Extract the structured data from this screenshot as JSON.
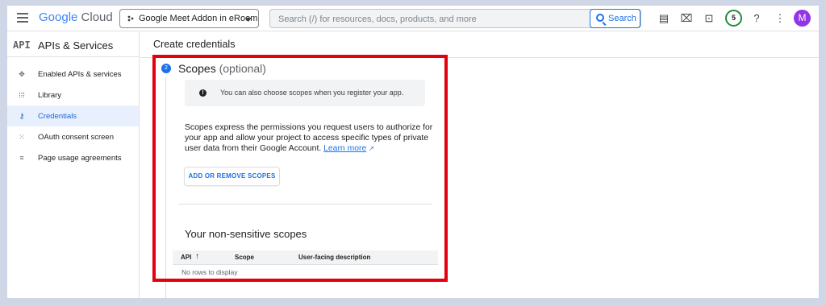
{
  "header": {
    "logo_google": "Google",
    "logo_cloud": "Cloud",
    "project_name": "Google Meet Addon in eRoom",
    "search_placeholder": "Search (/) for resources, docs, products, and more",
    "search_button": "Search",
    "notification_count": "5",
    "avatar_initial": "M"
  },
  "sidebar": {
    "api_icon": "API",
    "title": "APIs & Services",
    "items": [
      {
        "label": "Enabled APIs & services",
        "icon": "diamond-arrows-icon",
        "glyph": "✥"
      },
      {
        "label": "Library",
        "icon": "library-icon",
        "glyph": "⁞⁞⁞"
      },
      {
        "label": "Credentials",
        "icon": "key-icon",
        "glyph": "⚷"
      },
      {
        "label": "OAuth consent screen",
        "icon": "dots-grid-icon",
        "glyph": "⁙"
      },
      {
        "label": "Page usage agreements",
        "icon": "settings-list-icon",
        "glyph": "≡"
      }
    ],
    "active_index": 2
  },
  "main": {
    "page_title": "Create credentials",
    "step_number": "2",
    "step_title": "Scopes",
    "step_optional": "(optional)",
    "info_text": "You can also choose scopes when you register your app.",
    "description": "Scopes express the permissions you request users to authorize for your app and allow your project to access specific types of private user data from their Google Account.",
    "learn_more": "Learn more",
    "add_scopes_button": "ADD OR REMOVE SCOPES",
    "nonsensitive_title": "Your non-sensitive scopes",
    "table": {
      "columns": [
        "API",
        "Scope",
        "User-facing description"
      ],
      "sort_icon": "↑",
      "empty_text": "No rows to display"
    }
  },
  "colors": {
    "highlight": "#e3000f",
    "accent": "#1a73e8",
    "active_bg": "#e8f0fe"
  }
}
